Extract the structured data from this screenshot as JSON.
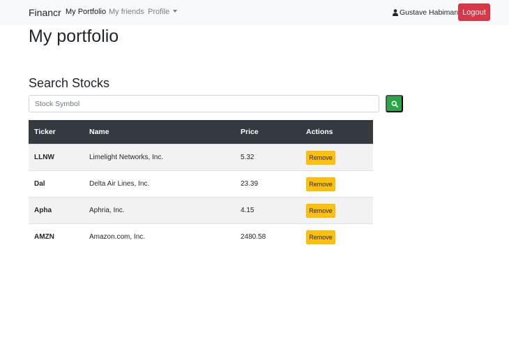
{
  "navbar": {
    "brand": "Financr",
    "links": [
      {
        "label": "My Portfolio",
        "active": true
      },
      {
        "label": "My friends",
        "active": false
      },
      {
        "label": "Profile",
        "active": false
      }
    ],
    "user_name": "Gustave Habimana",
    "user_icon": "user-icon",
    "logout_label": "Logout"
  },
  "main": {
    "page_title": "My portfolio",
    "search_section_title": "Search Stocks",
    "search_placeholder": "Stock Symbol",
    "search_icon": "search-icon"
  },
  "table": {
    "headers": [
      "Ticker",
      "Name",
      "Price",
      "Actions"
    ],
    "rows": [
      {
        "ticker": "LLNW",
        "name": "Limelight Networks, Inc.",
        "price": "5.32",
        "action": "Remove"
      },
      {
        "ticker": "Dal",
        "name": "Delta Air Lines, Inc.",
        "price": "23.39",
        "action": "Remove"
      },
      {
        "ticker": "Apha",
        "name": "Aphria, Inc.",
        "price": "4.15",
        "action": "Remove"
      },
      {
        "ticker": "AMZN",
        "name": "Amazon.com, Inc.",
        "price": "2480.58",
        "action": "Remove"
      }
    ]
  },
  "colors": {
    "navbar_bg": "#f8f9fa",
    "logout_red": "#dc3545",
    "search_green": "#28a745",
    "table_header_dark": "#343a40",
    "remove_yellow": "#ffc107"
  }
}
